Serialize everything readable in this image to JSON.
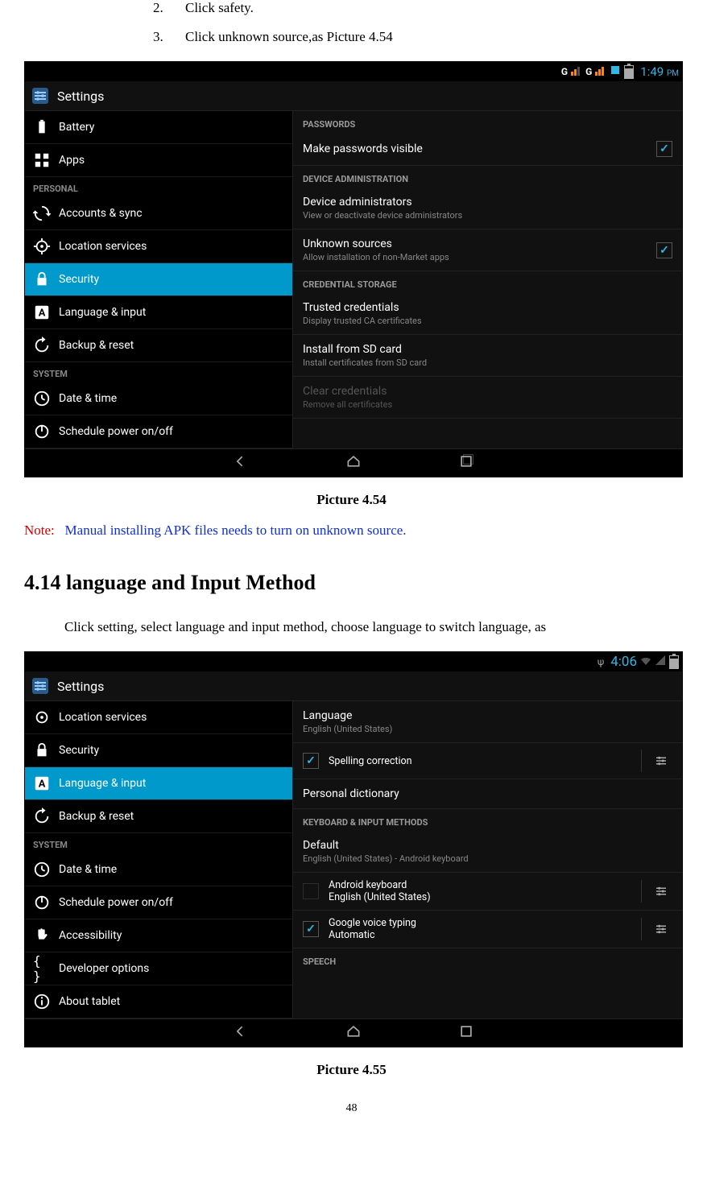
{
  "steps": [
    {
      "n": "2.",
      "text": "Click safety."
    },
    {
      "n": "3.",
      "text": "Click unknown source,as Picture 4.54"
    }
  ],
  "caption1": "Picture 4.54",
  "note_label": "Note:",
  "note_body": "Manual installing APK files needs to turn on unknown source.",
  "section_heading": "4.14  language and Input Method",
  "para_lang": "Click setting, select language and input method, choose language to switch language, as",
  "caption2": "Picture 4.55",
  "page_number": "48",
  "shot1": {
    "time": "1:49",
    "ampm": "PM",
    "status_g": "G",
    "header": "Settings",
    "sidebar_top": [
      {
        "label": "Battery",
        "icon": "battery"
      },
      {
        "label": "Apps",
        "icon": "apps"
      }
    ],
    "cat_personal": "PERSONAL",
    "sidebar_personal": [
      {
        "label": "Accounts & sync",
        "icon": "sync"
      },
      {
        "label": "Location services",
        "icon": "target"
      },
      {
        "label": "Security",
        "icon": "lock",
        "active": true
      },
      {
        "label": "Language & input",
        "icon": "A"
      },
      {
        "label": "Backup & reset",
        "icon": "backup"
      }
    ],
    "cat_system": "SYSTEM",
    "sidebar_system": [
      {
        "label": "Date & time",
        "icon": "clock"
      },
      {
        "label": "Schedule power on/off",
        "icon": "power"
      }
    ],
    "h_passwords": "PASSWORDS",
    "row_pwvis": {
      "title": "Make passwords visible",
      "checked": true
    },
    "h_admin": "DEVICE ADMINISTRATION",
    "row_admin": {
      "title": "Device administrators",
      "sub": "View or deactivate device administrators"
    },
    "row_unknown": {
      "title": "Unknown sources",
      "sub": "Allow installation of non-Market apps",
      "checked": true
    },
    "h_cred": "CREDENTIAL STORAGE",
    "row_trusted": {
      "title": "Trusted credentials",
      "sub": "Display trusted CA certificates"
    },
    "row_install": {
      "title": "Install from SD card",
      "sub": "Install certificates from SD card"
    },
    "row_clear": {
      "title": "Clear credentials",
      "sub": "Remove all certificates"
    }
  },
  "shot2": {
    "time": "4:06",
    "header": "Settings",
    "sidebar": [
      {
        "label": "Location services",
        "icon": "target"
      },
      {
        "label": "Security",
        "icon": "lock"
      },
      {
        "label": "Language & input",
        "icon": "A",
        "active": true
      },
      {
        "label": "Backup & reset",
        "icon": "backup"
      }
    ],
    "cat_system": "SYSTEM",
    "sidebar_system": [
      {
        "label": "Date & time",
        "icon": "clock"
      },
      {
        "label": "Schedule power on/off",
        "icon": "power"
      },
      {
        "label": "Accessibility",
        "icon": "hand"
      },
      {
        "label": "Developer options",
        "icon": "braces"
      },
      {
        "label": "About tablet",
        "icon": "info"
      }
    ],
    "row_lang": {
      "title": "Language",
      "sub": "English (United States)"
    },
    "row_spell": {
      "title": "Spelling correction",
      "checked": true
    },
    "row_dict": {
      "title": "Personal dictionary"
    },
    "h_kbd": "KEYBOARD & INPUT METHODS",
    "row_default": {
      "title": "Default",
      "sub": "English (United States) - Android keyboard"
    },
    "row_akbd": {
      "title": "Android keyboard",
      "sub": "English (United States)",
      "checked": false
    },
    "row_gvoice": {
      "title": "Google voice typing",
      "sub": "Automatic",
      "checked": true
    },
    "h_speech": "SPEECH"
  }
}
